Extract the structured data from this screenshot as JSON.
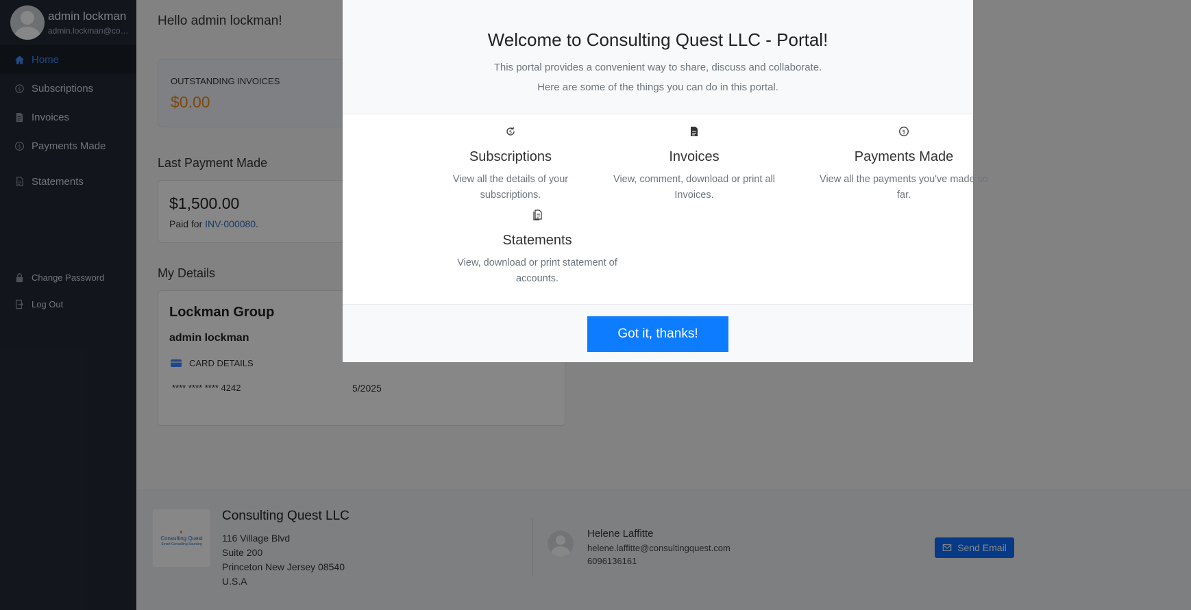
{
  "sidebar": {
    "user_name": "admin lockman",
    "user_email": "admin.lockman@consultingquest.com",
    "nav": [
      {
        "label": "Home",
        "icon": "home-icon"
      },
      {
        "label": "Subscriptions",
        "icon": "subscriptions-icon"
      },
      {
        "label": "Invoices",
        "icon": "invoice-icon"
      },
      {
        "label": "Payments Made",
        "icon": "dollar-circle-icon"
      },
      {
        "label": "Statements",
        "icon": "statement-icon"
      }
    ],
    "lower": [
      {
        "label": "Change Password",
        "icon": "lock-icon"
      },
      {
        "label": "Log Out",
        "icon": "logout-icon"
      }
    ]
  },
  "main": {
    "greeting": "Hello admin lockman!",
    "outstanding": {
      "label": "OUTSTANDING INVOICES",
      "value": "$0.00"
    },
    "last_payment": {
      "title": "Last Payment Made",
      "amount": "$1,500.00",
      "paid_for": "Paid for",
      "invoice": "INV-000080",
      "suffix": "."
    },
    "details": {
      "title": "My Details",
      "company": "Lockman Group",
      "contact": "admin lockman",
      "card_label": "CARD DETAILS",
      "card_number": "**** **** **** 4242",
      "card_expiry": "5/2025"
    }
  },
  "footer": {
    "logo_line1": "Consulting Quest",
    "logo_line2": "Smart Consulting Sourcing",
    "company": "Consulting Quest LLC",
    "address": [
      "116 Village Blvd",
      "Suite 200",
      "Princeton New Jersey 08540",
      "U.S.A"
    ],
    "rep_name": "Helene Laffitte",
    "rep_email": "helene.laffitte@consultingquest.com",
    "rep_phone": "6096136161",
    "send_email": "Send Email"
  },
  "modal": {
    "title": "Welcome to Consulting Quest LLC - Portal!",
    "subtitle1": "This portal provides a convenient way to share, discuss and collaborate.",
    "subtitle2": "Here are some of the things you can do in this portal.",
    "features": [
      {
        "title": "Subscriptions",
        "desc": "View all the details of your subscriptions.",
        "icon": "subscriptions-icon"
      },
      {
        "title": "Invoices",
        "desc": "View, comment, download or print all Invoices.",
        "icon": "invoice-icon"
      },
      {
        "title": "Payments Made",
        "desc": "View all the payments you've made so far.",
        "icon": "dollar-circle-icon"
      },
      {
        "title": "Statements",
        "desc": "View, download or print statement of accounts.",
        "icon": "statement-icon"
      }
    ],
    "button": "Got it, thanks!"
  },
  "colors": {
    "accent": "#0d7cff",
    "sidebar": "#232b36",
    "outstanding_value": "#ef8a17",
    "active_nav": "#3d8bfd"
  }
}
